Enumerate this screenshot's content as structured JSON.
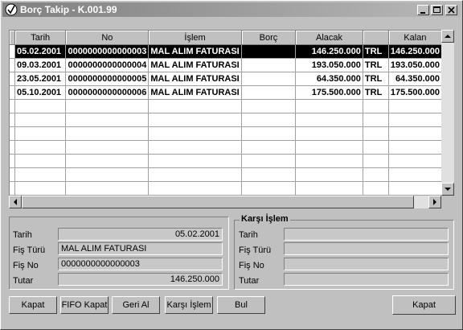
{
  "window": {
    "title": "Borç Takip - K.001.99"
  },
  "grid": {
    "columns": [
      "Tarih",
      "No",
      "İşlem",
      "Borç",
      "Alacak",
      "",
      "Kalan"
    ],
    "rows": [
      {
        "tarih": "05.02.2001",
        "no": "0000000000000003",
        "islem": "MAL ALIM FATURASI",
        "borc": "",
        "alacak": "146.250.000",
        "birim": "TRL",
        "kalan": "146.250.000",
        "selected": true
      },
      {
        "tarih": "09.03.2001",
        "no": "0000000000000004",
        "islem": "MAL ALIM FATURASI",
        "borc": "",
        "alacak": "193.050.000",
        "birim": "TRL",
        "kalan": "193.050.000",
        "selected": false
      },
      {
        "tarih": "23.05.2001",
        "no": "0000000000000005",
        "islem": "MAL ALIM FATURASI",
        "borc": "",
        "alacak": "64.350.000",
        "birim": "TRL",
        "kalan": "64.350.000",
        "selected": false
      },
      {
        "tarih": "05.10.2001",
        "no": "0000000000000006",
        "islem": "MAL ALIM FATURASI",
        "borc": "",
        "alacak": "175.500.000",
        "birim": "TRL",
        "kalan": "175.500.000",
        "selected": false
      }
    ],
    "empty_rows": 7
  },
  "details": {
    "tarih_label": "Tarih",
    "tarih_value": "05.02.2001",
    "fis_turu_label": "Fiş Türü",
    "fis_turu_value": "MAL ALIM FATURASI",
    "fis_no_label": "Fiş No",
    "fis_no_value": "0000000000000003",
    "tutar_label": "Tutar",
    "tutar_value": "146.250.000"
  },
  "karsi_islem": {
    "legend": "Karşı İşlem",
    "tarih_label": "Tarih",
    "fis_turu_label": "Fiş Türü",
    "fis_no_label": "Fiş No",
    "tutar_label": "Tutar",
    "tarih_value": "",
    "fis_turu_value": "",
    "fis_no_value": "",
    "tutar_value": ""
  },
  "buttons": {
    "kapat": "Kapat",
    "fifo_kapat": "FIFO Kapat",
    "geri_al": "Geri Al",
    "karsi_islem": "Karşı İşlem",
    "bul": "Bul",
    "kapat_close": "Kapat"
  },
  "icons": {
    "app": "checkmark-circle-icon",
    "minimize": "minimize-icon",
    "maximize": "maximize-icon",
    "close": "close-icon"
  }
}
